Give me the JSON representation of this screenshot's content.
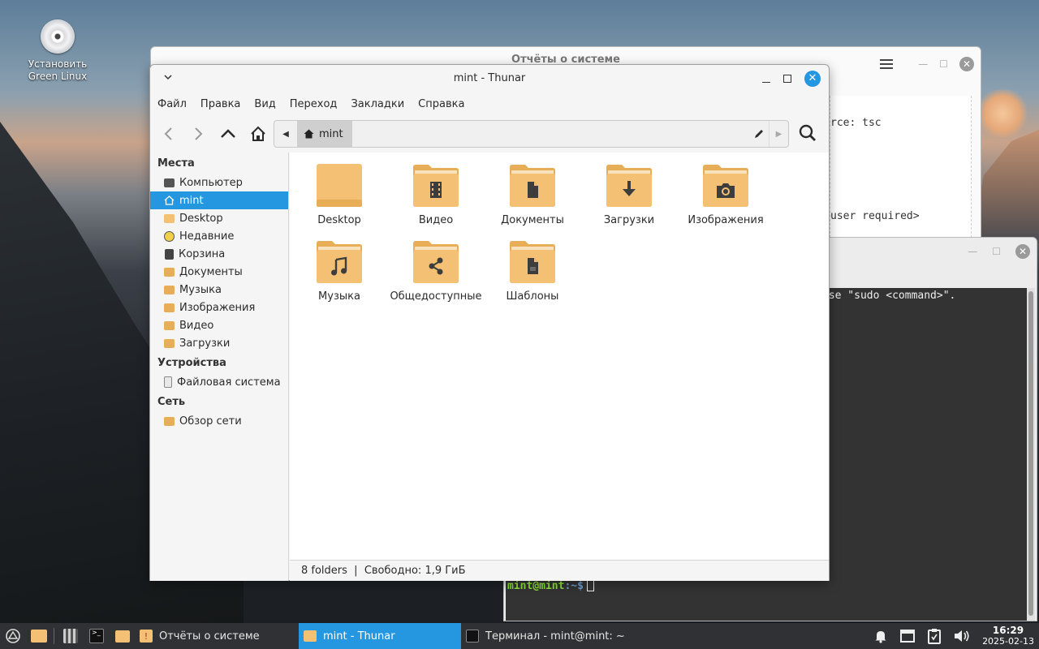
{
  "desktop": {
    "icon_label_line1": "Установить",
    "icon_label_line2": "Green Linux"
  },
  "reports_window": {
    "title": "Отчёты о системе",
    "text_line1": "rce: tsc",
    "text_line2": "user required>"
  },
  "terminal_window": {
    "text_line1": "use \"sudo <command>\".",
    "prompt_user": "mint@mint",
    "prompt_path": ":~$"
  },
  "thunar": {
    "title": "mint - Thunar",
    "menu": [
      "Файл",
      "Правка",
      "Вид",
      "Переход",
      "Закладки",
      "Справка"
    ],
    "path_crumb": "mint",
    "sidebar": {
      "places_header": "Места",
      "places": [
        {
          "label": "Компьютер",
          "icon": "computer-icon"
        },
        {
          "label": "mint",
          "icon": "home-icon",
          "selected": true
        },
        {
          "label": "Desktop",
          "icon": "folder-icon"
        },
        {
          "label": "Недавние",
          "icon": "recent-icon"
        },
        {
          "label": "Корзина",
          "icon": "trash-icon"
        },
        {
          "label": "Документы",
          "icon": "folder-documents-icon"
        },
        {
          "label": "Музыка",
          "icon": "folder-music-icon"
        },
        {
          "label": "Изображения",
          "icon": "folder-pictures-icon"
        },
        {
          "label": "Видео",
          "icon": "folder-videos-icon"
        },
        {
          "label": "Загрузки",
          "icon": "folder-downloads-icon"
        }
      ],
      "devices_header": "Устройства",
      "devices": [
        {
          "label": "Файловая система",
          "icon": "drive-icon"
        }
      ],
      "network_header": "Сеть",
      "network": [
        {
          "label": "Обзор сети",
          "icon": "network-icon"
        }
      ]
    },
    "files": [
      {
        "label": "Desktop",
        "emblem": "none"
      },
      {
        "label": "Видео",
        "emblem": "film"
      },
      {
        "label": "Документы",
        "emblem": "document"
      },
      {
        "label": "Загрузки",
        "emblem": "download"
      },
      {
        "label": "Изображения",
        "emblem": "camera"
      },
      {
        "label": "Музыка",
        "emblem": "music"
      },
      {
        "label": "Общедоступные",
        "emblem": "share"
      },
      {
        "label": "Шаблоны",
        "emblem": "template"
      }
    ],
    "status": "8 folders  |  Свободно: 1,9 ГиБ"
  },
  "taskbar": {
    "tasks": [
      {
        "label": "Отчёты о системе"
      },
      {
        "label": "mint - Thunar",
        "active": true
      },
      {
        "label": "Терминал - mint@mint: ~"
      }
    ],
    "clock_time": "16:29",
    "clock_date": "2025-02-13"
  },
  "colors": {
    "accent": "#2596e0",
    "folder": "#f3c074",
    "folder_dark": "#e7ad57",
    "taskbar": "#2f3134"
  }
}
